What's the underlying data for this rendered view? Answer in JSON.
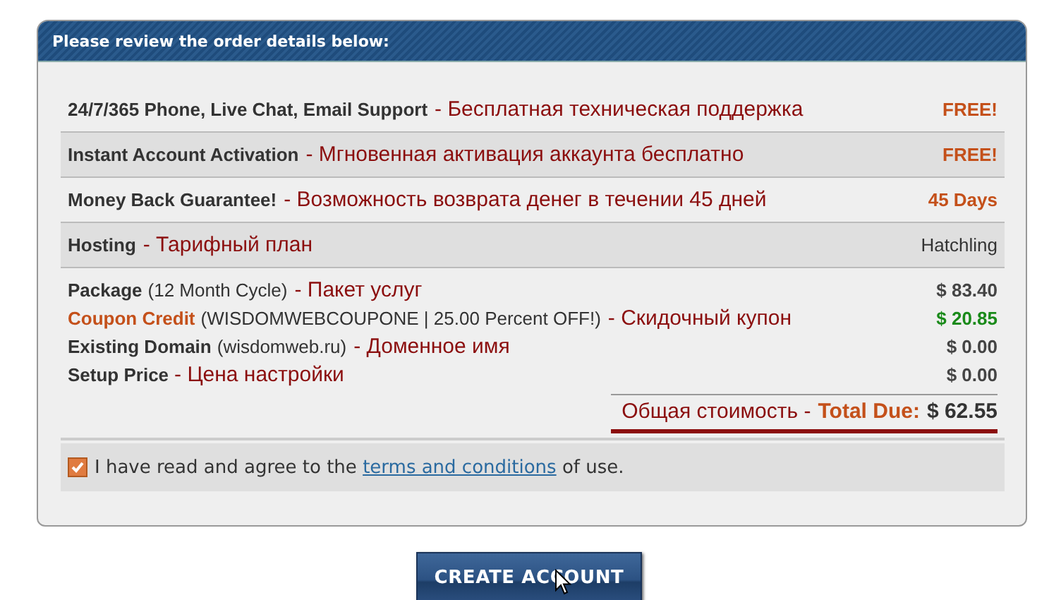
{
  "panel": {
    "title": "Please review the order details below:"
  },
  "features": [
    {
      "label": "24/7/365 Phone, Live Chat, Email Support",
      "note": "- Бесплатная техническая поддержка",
      "value": "FREE!",
      "kind": "highlight"
    },
    {
      "label": "Instant Account Activation",
      "note": "- Мгновенная активация аккаунта бесплатно",
      "value": "FREE!",
      "kind": "highlight"
    },
    {
      "label": "Money Back Guarantee!",
      "note": "- Возможность возврата денег в течении 45 дней",
      "value": "45 Days",
      "kind": "highlight"
    },
    {
      "label": "Hosting",
      "note": "- Тарифный план",
      "value": "Hatchling",
      "kind": "plain"
    }
  ],
  "line_items": [
    {
      "label": "Package",
      "detail": "(12 Month Cycle)",
      "note": "- Пакет услуг",
      "amount": "$ 83.40",
      "kind": "normal"
    },
    {
      "label": "Coupon Credit",
      "detail": "(WISDOMWEBCOUPONE | 25.00 Percent OFF!)",
      "note": "- Скидочный купон",
      "amount": "$ 20.85",
      "kind": "coupon"
    },
    {
      "label": "Existing Domain",
      "detail": "(wisdomweb.ru)",
      "note": "- Доменное имя",
      "amount": "$ 0.00",
      "kind": "normal"
    },
    {
      "label": "Setup Price",
      "note": "- Цена настройки",
      "amount": "$ 0.00",
      "kind": "normal"
    }
  ],
  "total": {
    "note": "Общая стоимость -",
    "label": "Total Due:",
    "amount": "$ 62.55"
  },
  "agreement": {
    "checked": true,
    "before": "I have read and agree to the",
    "link": "terms and conditions",
    "after": "of use."
  },
  "button": {
    "label": "CREATE ACCOUNT"
  }
}
